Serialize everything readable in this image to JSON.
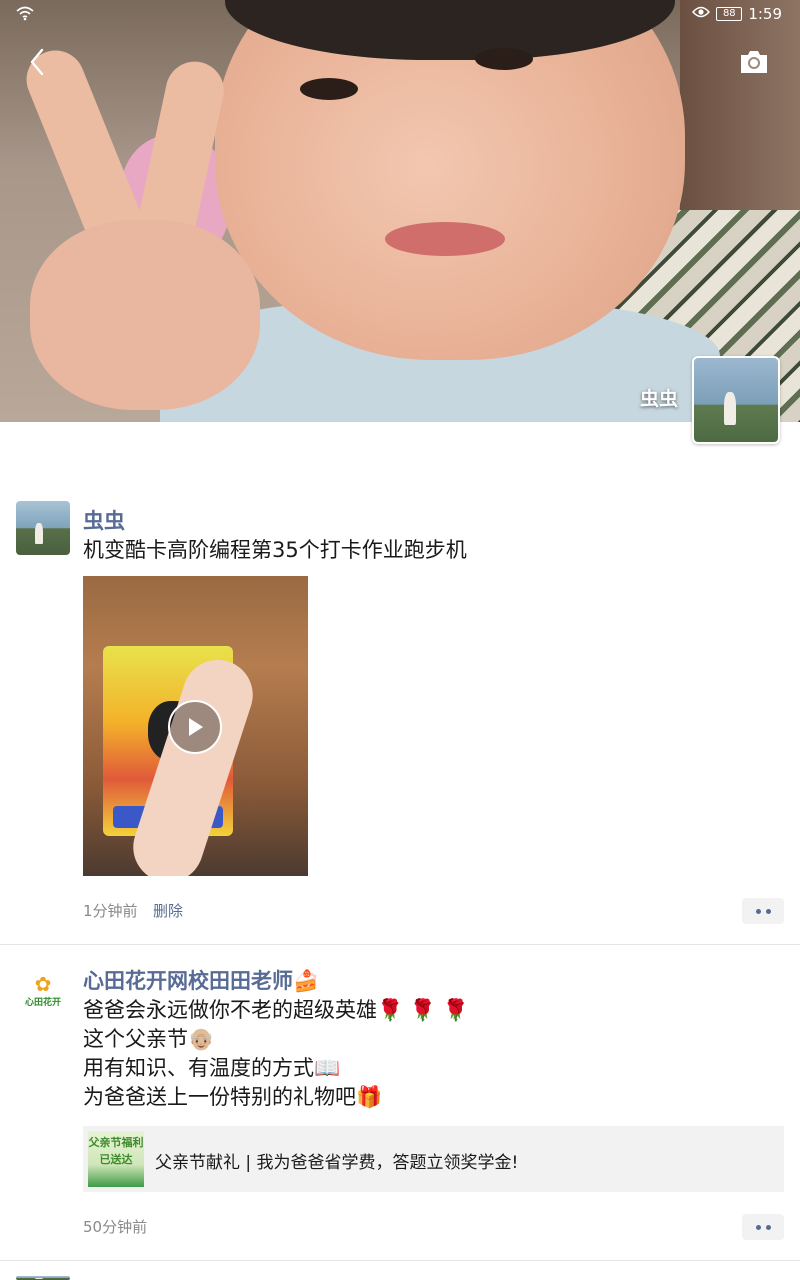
{
  "status_bar": {
    "battery": "88",
    "time": "1:59"
  },
  "cover": {
    "name": "虫虫"
  },
  "posts": [
    {
      "author": "虫虫",
      "text": "机变酷卡高阶编程第35个打卡作业跑步机",
      "time": "1分钟前",
      "delete_label": "删除"
    },
    {
      "author": "心田花开网校田田老师🍰",
      "avatar_logo_text": "心田花开",
      "lines": [
        "爸爸会永远做你不老的超级英雄🌹 🌹 🌹",
        "这个父亲节👴🏼",
        "用有知识、有温度的方式📖",
        "为爸爸送上一份特别的礼物吧🎁"
      ],
      "link_card": {
        "thumb_line1": "父亲节福利",
        "thumb_line2": "已送达",
        "title": "父亲节献礼 | 我为爸爸省学费，答题立领奖学金!"
      },
      "time": "50分钟前"
    }
  ]
}
